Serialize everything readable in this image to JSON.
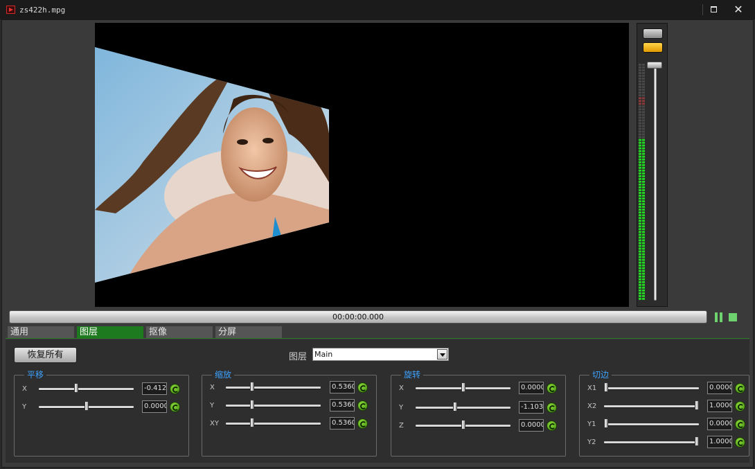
{
  "window": {
    "title": "zs422h.mpg",
    "icons": [
      "app-icon",
      "maximize-icon",
      "close-icon"
    ]
  },
  "timeline": {
    "time": "00:00:00.000"
  },
  "tabs": [
    "通用",
    "图层",
    "抠像",
    "分屏"
  ],
  "active_tab": "图层",
  "panel": {
    "restore_all": "恢复所有",
    "layer_label": "图层",
    "layer_value": "Main"
  },
  "groups": {
    "translate": {
      "title": "平移",
      "rows": [
        {
          "label": "X",
          "value": "-0.412",
          "slider": 0.39
        },
        {
          "label": "Y",
          "value": "0.0000",
          "slider": 0.5
        }
      ]
    },
    "scale": {
      "title": "缩放",
      "rows": [
        {
          "label": "X",
          "value": "0.5360",
          "slider": 0.27
        },
        {
          "label": "Y",
          "value": "0.5360",
          "slider": 0.27
        },
        {
          "label": "XY",
          "value": "0.5360",
          "slider": 0.27
        }
      ]
    },
    "rotate": {
      "title": "旋转",
      "rows": [
        {
          "label": "X",
          "value": "0.0000",
          "slider": 0.5
        },
        {
          "label": "Y",
          "value": "-1.103",
          "slider": 0.41
        },
        {
          "label": "Z",
          "value": "0.0000",
          "slider": 0.5
        }
      ]
    },
    "crop": {
      "title": "切边",
      "rows": [
        {
          "label": "X1",
          "value": "0.0000",
          "slider": 0.0
        },
        {
          "label": "X2",
          "value": "1.0000",
          "slider": 1.0
        },
        {
          "label": "Y1",
          "value": "0.0000",
          "slider": 0.0
        },
        {
          "label": "Y2",
          "value": "1.0000",
          "slider": 1.0
        }
      ]
    }
  },
  "colors": {
    "accent_green": "#1e7a1e",
    "group_title": "#3da2ff",
    "meter_green": "#22dd22",
    "play_green": "#6ed36e",
    "orange": "#f2b400"
  },
  "meter": {
    "level": 0.68
  }
}
